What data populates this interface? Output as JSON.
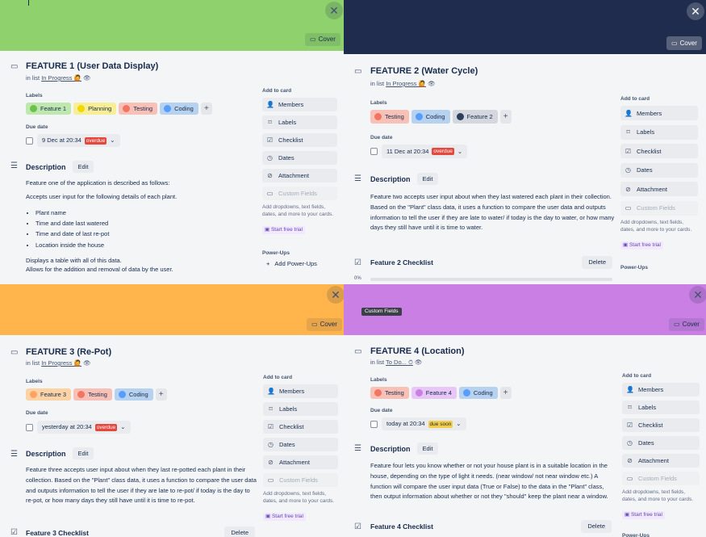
{
  "colors": {
    "green": "#8fd16d",
    "navy": "#1f2c4e",
    "orange": "#ffb44c",
    "purple": "#c97fe3",
    "chip_green": "#bfe8b0",
    "chip_yellow": "#f8ee95",
    "chip_red": "#f8c1b8",
    "chip_blue": "#b6d2ee",
    "chip_purple": "#e8c6f5",
    "chip_navy": "#d4d7de",
    "overdue": "#e2483d",
    "duesoon": "#f5cd47"
  },
  "common": {
    "cover_label": "Cover",
    "labels_heading": "Labels",
    "due_heading": "Due date",
    "description_heading": "Description",
    "edit_label": "Edit",
    "add_to_card": "Add to card",
    "members": "Members",
    "labels": "Labels",
    "checklist": "Checklist",
    "dates": "Dates",
    "attachment": "Attachment",
    "custom_fields": "Custom Fields",
    "promo": "Add dropdowns, text fields, dates, and more to your cards.",
    "trial": "Start free trial",
    "powerups_heading": "Power-Ups",
    "add_powerups": "Add Power-Ups",
    "delete_label": "Delete",
    "close_glyph": "✕",
    "plus_glyph": "+"
  },
  "cards": [
    {
      "title": "FEATURE 1 (User Data Display)",
      "in_list_prefix": "in list",
      "list_name": "In Progress 🙋",
      "labels": [
        "Feature 1",
        "Planning",
        "Testing",
        "Coding"
      ],
      "due": "9 Dec at 20:34",
      "due_badge": "overdue",
      "description": "Feature one of the application is described as follows:",
      "description2": "Accepts user input for the following details of each plant.",
      "bullets": [
        "Plant name",
        "Time and date last watered",
        "Time and date of last re-pot",
        "Location inside the house"
      ],
      "description3": "Displays a table with all of this data.",
      "description4": "Allows for the addition and removal of data by the user."
    },
    {
      "title": "FEATURE 2 (Water Cycle)",
      "in_list_prefix": "in list",
      "list_name": "In Progress 🙋",
      "labels": [
        "Testing",
        "Coding",
        "Feature 2"
      ],
      "due": "11 Dec at 20:34",
      "due_badge": "overdue",
      "description": "Feature two accepts user input about when they last watered each plant in their collection. Based on the \"Plant\" class data, it uses a function to compare the user data and outputs information to tell the user if they are late to water/ if today is the day to water, or how many days they still have until it is time to water.",
      "checklist": "Feature 2 Checklist",
      "progress": "0%"
    },
    {
      "title": "FEATURE 3 (Re-Pot)",
      "in_list_prefix": "in list",
      "list_name": "In Progress 🙋",
      "labels": [
        "Feature 3",
        "Testing",
        "Coding"
      ],
      "due": "yesterday at 20:34",
      "due_badge": "overdue",
      "description": "Feature three accepts user input about when they last re-potted each plant in their collection. Based on the \"Plant\" class data, it uses a function to compare the user data and outputs information to tell the user if they are late to re-pot/ if today is the day to re-pot, or how many days they still have until it is time to re-pot.",
      "checklist": "Feature 3 Checklist"
    },
    {
      "title": "FEATURE 4 (Location)",
      "in_list_prefix": "in list",
      "list_name": "To Do... ⏱",
      "labels": [
        "Testing",
        "Feature 4",
        "Coding"
      ],
      "due": "today at 20:34",
      "due_badge": "due soon",
      "description": "Feature four lets you know whether or not your house plant is in a suitable location in the house, depending on the type of light it needs. (near window/ not near window etc.) A function will compare the user input data (True or False) to the data in the \"Plant\" class, then output information about whether or not they \"should\" keep the plant near a window.",
      "checklist": "Feature 4 Checklist",
      "tooltip": "Custom Fields"
    }
  ]
}
